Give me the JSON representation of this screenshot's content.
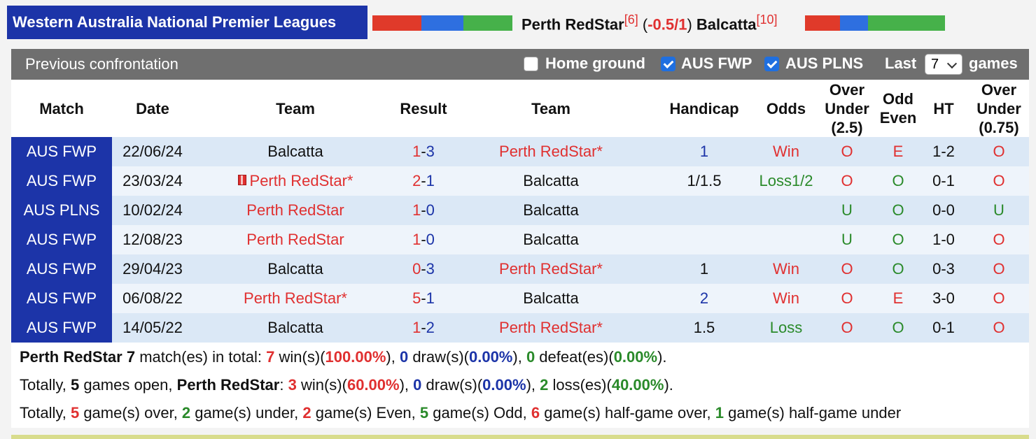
{
  "header": {
    "league": "Western Australia National Premier Leagues",
    "home_team": "Perth RedStar",
    "home_rank": "[6]",
    "handicap": "-0.5/1",
    "away_team": "Balcatta",
    "away_rank": "[10]",
    "colors": {
      "red": "#e03a2a",
      "blue": "#2e6fe0",
      "green": "#46b14a"
    }
  },
  "panel": {
    "title": "Previous confrontation",
    "filters": [
      {
        "label": "Home ground",
        "checked": false
      },
      {
        "label": "AUS FWP",
        "checked": true
      },
      {
        "label": "AUS PLNS",
        "checked": true
      }
    ],
    "last_label": "Last",
    "last_value": "7",
    "games_label": "games"
  },
  "table": {
    "headers": [
      "Match",
      "Date",
      "Team",
      "Result",
      "Team",
      "Handicap",
      "Odds",
      "Over Under (2.5)",
      "Odd Even",
      "HT",
      "Over Under (0.75)"
    ],
    "rows": [
      {
        "match": "AUS FWP",
        "date": "22/06/24",
        "home": "Balcatta",
        "home_red": false,
        "home_flag": false,
        "score_h": "1",
        "score_a": "3",
        "away": "Perth RedStar*",
        "away_red": true,
        "handicap": "1",
        "hc_color": "blue",
        "odds": "Win",
        "odds_color": "red",
        "ou": "O",
        "ou_color": "red",
        "oe": "E",
        "oe_color": "red",
        "ht": "1-2",
        "ou2": "O",
        "ou2_color": "red"
      },
      {
        "match": "AUS FWP",
        "date": "23/03/24",
        "home": "Perth RedStar*",
        "home_red": true,
        "home_flag": true,
        "score_h": "2",
        "score_a": "1",
        "away": "Balcatta",
        "away_red": false,
        "handicap": "1/1.5",
        "hc_color": "black",
        "odds": "Loss1/2",
        "odds_color": "green",
        "ou": "O",
        "ou_color": "red",
        "oe": "O",
        "oe_color": "green",
        "ht": "0-1",
        "ou2": "O",
        "ou2_color": "red"
      },
      {
        "match": "AUS PLNS",
        "date": "10/02/24",
        "home": "Perth RedStar",
        "home_red": true,
        "home_flag": false,
        "score_h": "1",
        "score_a": "0",
        "away": "Balcatta",
        "away_red": false,
        "handicap": "",
        "hc_color": "black",
        "odds": "",
        "odds_color": "black",
        "ou": "U",
        "ou_color": "green",
        "oe": "O",
        "oe_color": "green",
        "ht": "0-0",
        "ou2": "U",
        "ou2_color": "green"
      },
      {
        "match": "AUS FWP",
        "date": "12/08/23",
        "home": "Perth RedStar",
        "home_red": true,
        "home_flag": false,
        "score_h": "1",
        "score_a": "0",
        "away": "Balcatta",
        "away_red": false,
        "handicap": "",
        "hc_color": "black",
        "odds": "",
        "odds_color": "black",
        "ou": "U",
        "ou_color": "green",
        "oe": "O",
        "oe_color": "green",
        "ht": "1-0",
        "ou2": "O",
        "ou2_color": "red"
      },
      {
        "match": "AUS FWP",
        "date": "29/04/23",
        "home": "Balcatta",
        "home_red": false,
        "home_flag": false,
        "score_h": "0",
        "score_a": "3",
        "away": "Perth RedStar*",
        "away_red": true,
        "handicap": "1",
        "hc_color": "black",
        "odds": "Win",
        "odds_color": "red",
        "ou": "O",
        "ou_color": "red",
        "oe": "O",
        "oe_color": "green",
        "ht": "0-3",
        "ou2": "O",
        "ou2_color": "red"
      },
      {
        "match": "AUS FWP",
        "date": "06/08/22",
        "home": "Perth RedStar*",
        "home_red": true,
        "home_flag": false,
        "score_h": "5",
        "score_a": "1",
        "away": "Balcatta",
        "away_red": false,
        "handicap": "2",
        "hc_color": "blue",
        "odds": "Win",
        "odds_color": "red",
        "ou": "O",
        "ou_color": "red",
        "oe": "E",
        "oe_color": "red",
        "ht": "3-0",
        "ou2": "O",
        "ou2_color": "red"
      },
      {
        "match": "AUS FWP",
        "date": "14/05/22",
        "home": "Balcatta",
        "home_red": false,
        "home_flag": false,
        "score_h": "1",
        "score_a": "2",
        "away": "Perth RedStar*",
        "away_red": true,
        "handicap": "1.5",
        "hc_color": "black",
        "odds": "Loss",
        "odds_color": "green",
        "ou": "O",
        "ou_color": "red",
        "oe": "O",
        "oe_color": "green",
        "ht": "0-1",
        "ou2": "O",
        "ou2_color": "red"
      }
    ]
  },
  "summary": {
    "line1": {
      "team": "Perth RedStar",
      "total": "7",
      "t1": " match(es) in total: ",
      "wins": "7",
      "t2": " win(s)(",
      "win_pct": "100.00%",
      "t3": "), ",
      "draws": "0",
      "t4": " draw(s)(",
      "draw_pct": "0.00%",
      "t5": "), ",
      "defeats": "0",
      "t6": " defeat(es)(",
      "defeat_pct": "0.00%",
      "t7": ")."
    },
    "line2": {
      "p1": "Totally, ",
      "open": "5",
      "p2": " games open, ",
      "team": "Perth RedStar",
      "p3": ": ",
      "wins": "3",
      "p4": " win(s)(",
      "win_pct": "60.00%",
      "p5": "), ",
      "draws": "0",
      "p6": " draw(s)(",
      "draw_pct": "0.00%",
      "p7": "), ",
      "losses": "2",
      "p8": " loss(es)(",
      "loss_pct": "40.00%",
      "p9": ")."
    },
    "line3": {
      "p1": "Totally, ",
      "over": "5",
      "p2": " game(s) over, ",
      "under": "2",
      "p3": " game(s) under, ",
      "even": "2",
      "p4": " game(s) Even, ",
      "odd": "5",
      "p5": " game(s) Odd, ",
      "hg_over": "6",
      "p6": " game(s) half-game over, ",
      "hg_under": "1",
      "p7": " game(s) half-game under"
    }
  }
}
